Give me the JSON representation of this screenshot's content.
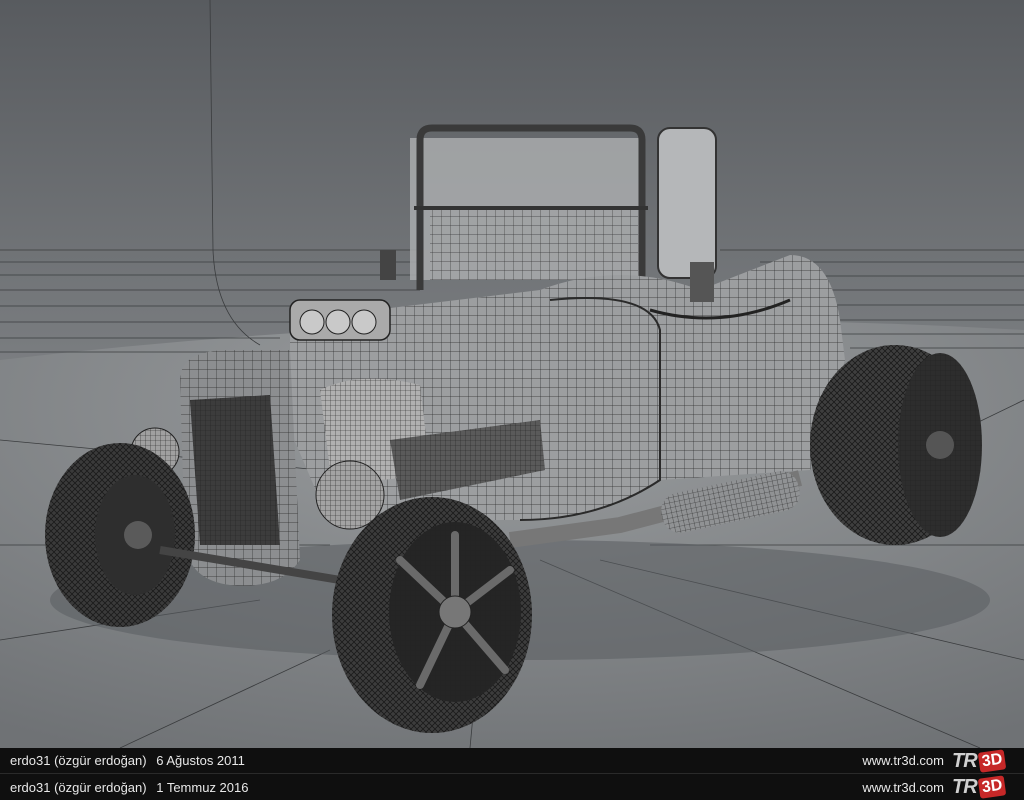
{
  "footer_rows": [
    {
      "author": "erdo31 (özgür erdoğan)",
      "date": "6 Ağustos 2011",
      "site": "www.tr3d.com"
    },
    {
      "author": "erdo31 (özgür erdoğan)",
      "date": "1 Temmuz 2016",
      "site": "www.tr3d.com"
    }
  ],
  "logo": {
    "left": "TR",
    "right": "3D",
    "accent": "#c62828"
  },
  "colors": {
    "studio_bg": "#6e7175",
    "floor": "#8a8d90",
    "wire": "#1c1c1c",
    "body": "#9a9a9a"
  }
}
